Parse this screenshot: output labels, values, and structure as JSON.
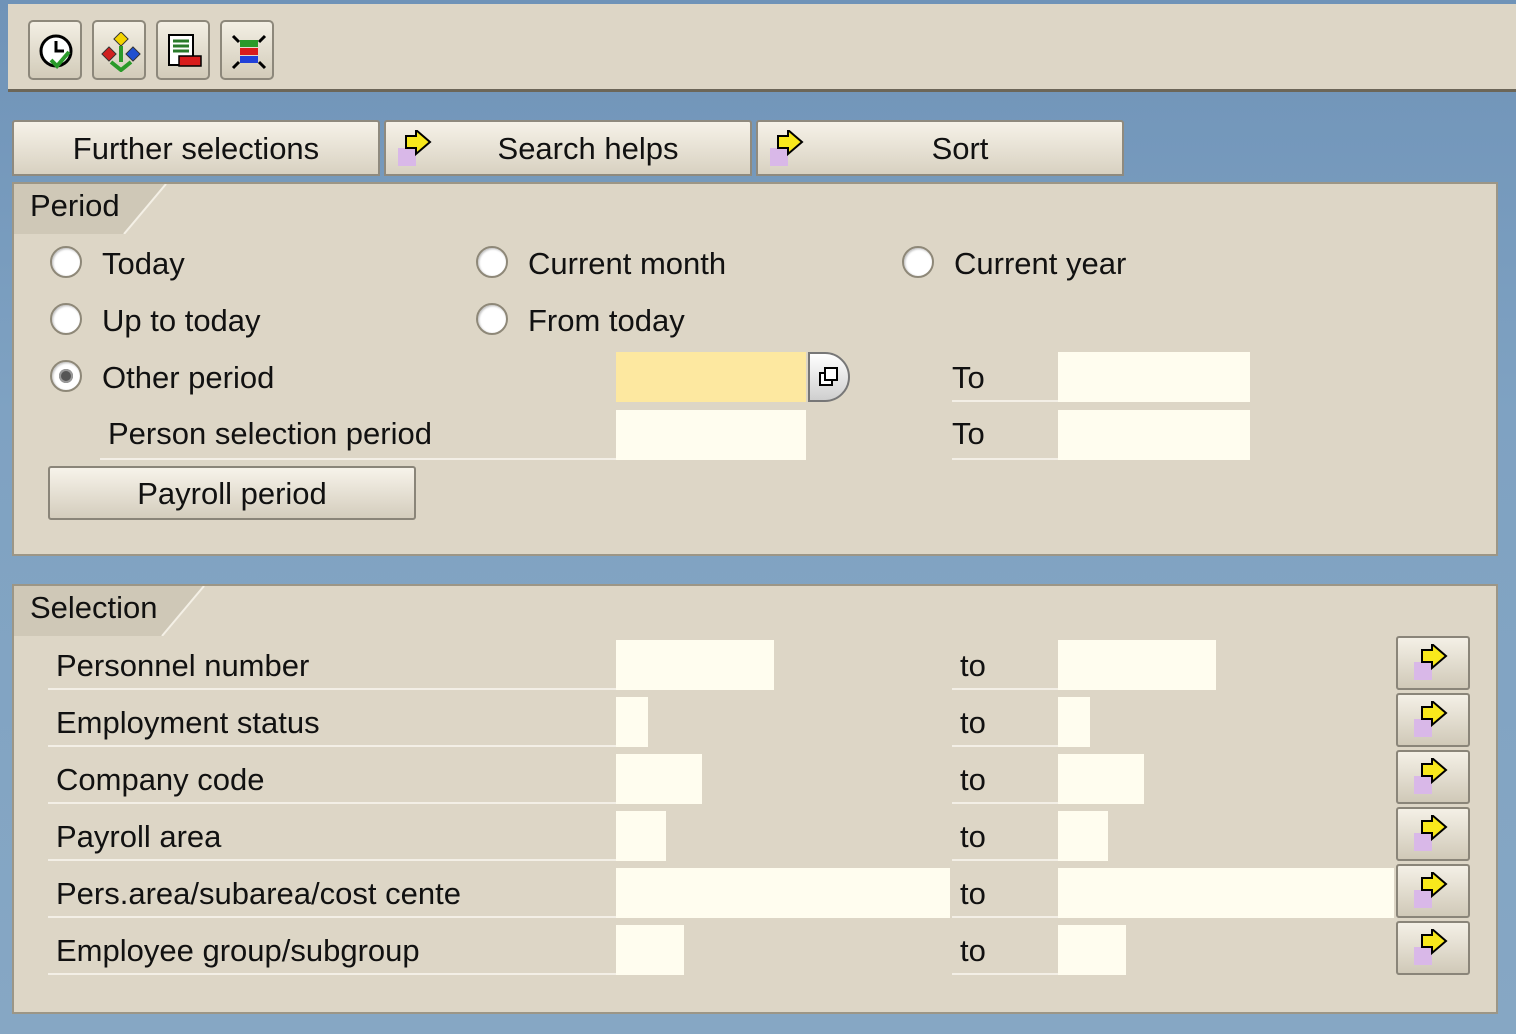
{
  "toolbar": {
    "icons": [
      "execute-clock-icon",
      "hierarchy-icon",
      "variant-icon",
      "selection-fields-icon"
    ]
  },
  "tabs": [
    {
      "label": "Further selections"
    },
    {
      "label": "Search helps"
    },
    {
      "label": "Sort"
    }
  ],
  "period": {
    "title": "Period",
    "radios": [
      {
        "label": "Today",
        "checked": false
      },
      {
        "label": "Current month",
        "checked": false
      },
      {
        "label": "Current year",
        "checked": false
      },
      {
        "label": "Up to today",
        "checked": false
      },
      {
        "label": "From today",
        "checked": false
      },
      {
        "label": "Other period",
        "checked": true
      }
    ],
    "person_selection_label": "Person selection period",
    "to_label": "To",
    "other_from_value": "",
    "other_to_value": "",
    "person_from_value": "",
    "person_to_value": "",
    "payroll_button": "Payroll period"
  },
  "selection": {
    "title": "Selection",
    "to_label": "to",
    "rows": [
      {
        "label": "Personnel number",
        "from": "",
        "to": ""
      },
      {
        "label": "Employment status",
        "from": "",
        "to": ""
      },
      {
        "label": "Company code",
        "from": "",
        "to": ""
      },
      {
        "label": "Payroll area",
        "from": "",
        "to": ""
      },
      {
        "label": "Pers.area/subarea/cost cente",
        "from": "",
        "to": ""
      },
      {
        "label": "Employee group/subgroup",
        "from": "",
        "to": ""
      }
    ]
  },
  "colors": {
    "panel": "#ddd6c6",
    "input": "#fffdef",
    "required_input": "#fde8a0",
    "arrow": "#f8e81c"
  }
}
